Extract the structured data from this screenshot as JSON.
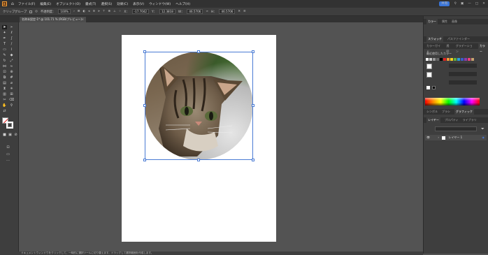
{
  "menubar": {
    "menus": [
      "ファイル(F)",
      "編集(E)",
      "オブジェクト(O)",
      "書式(T)",
      "選択(S)",
      "効果(C)",
      "表示(V)",
      "ウィンドウ(W)",
      "ヘルプ(H)"
    ],
    "share_label": "共有"
  },
  "control": {
    "group_label": "クリップグループ",
    "opacity_label": "不透明度：",
    "opacity_value": "100%",
    "x_label": "X：",
    "x_value": "-17.7042",
    "y_label": "Y：",
    "y_value": "12.3818",
    "w_label": "W：",
    "w_value": "46.5706",
    "h_label": "H：",
    "h_value": "46.5706"
  },
  "document": {
    "tab_label": "名称未設定-1* @ 101.71 % (RGB/プレビュー)"
  },
  "panels": {
    "top_tabs": [
      "カラー",
      "属性",
      "画像"
    ],
    "swatch_tabs": [
      "スウォッチ",
      "パスファインダー"
    ],
    "color_tabs": [
      "カラーガイド",
      "透明",
      "グラデーション",
      "カラー"
    ],
    "recent_label": "最近使用したカラー",
    "layer_tabs": [
      "レイヤー",
      "プロパティ",
      "ライブラリ"
    ],
    "layers_subtabs": [
      "シンボル",
      "ブラシ",
      "グラフィック"
    ],
    "layer_name": "レイヤー 1",
    "recent_colors": [
      "#ffffff",
      "#cccccc",
      "#999999",
      "#666666",
      "#000000",
      "#e02020",
      "#f29a3a",
      "#f5d020",
      "#60b040",
      "#2aa0d8",
      "#3a5cc8",
      "#8a3ab0",
      "#e8407a",
      "#c8a070"
    ]
  },
  "status": {
    "text": "ドキュメントウィンドウをクリックして、一時的に選択ツールに切り替えます。ドラッグして選択範囲を作成します。"
  },
  "colors": {
    "accent": "#3a75d8",
    "selection": "#4a7bd4"
  }
}
